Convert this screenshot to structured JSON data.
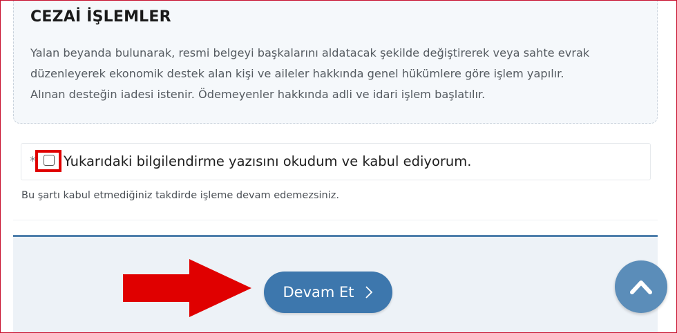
{
  "info": {
    "title": "CEZAİ İŞLEMLER",
    "lines": [
      "Yalan beyanda bulunarak, resmi belgeyi başkalarını aldatacak şekilde değiştirerek veya sahte evrak",
      "düzenleyerek ekonomik destek alan kişi ve aileler hakkında genel hükümlere göre işlem yapılır.",
      "Alınan desteğin iadesi istenir. Ödemeyenler hakkında adli ve idari işlem başlatılır."
    ]
  },
  "consent": {
    "required_mark": "*",
    "label": "Yukarıdaki bilgilendirme yazısını okudum ve kabul ediyorum.",
    "checked": false,
    "warning": "Bu şartı kabul etmediğiniz takdirde işleme devam edemezsiniz."
  },
  "footer": {
    "continue_label": "Devam Et",
    "continue_icon": "chevron-right-icon",
    "scroll_top_icon": "chevron-up-icon"
  },
  "annotations": {
    "highlight_color": "#e00000",
    "arrow_color": "#e00000"
  },
  "colors": {
    "button": "#3d77ad",
    "scroll_button": "#5b8db9",
    "footer_border": "#4f7fac"
  }
}
